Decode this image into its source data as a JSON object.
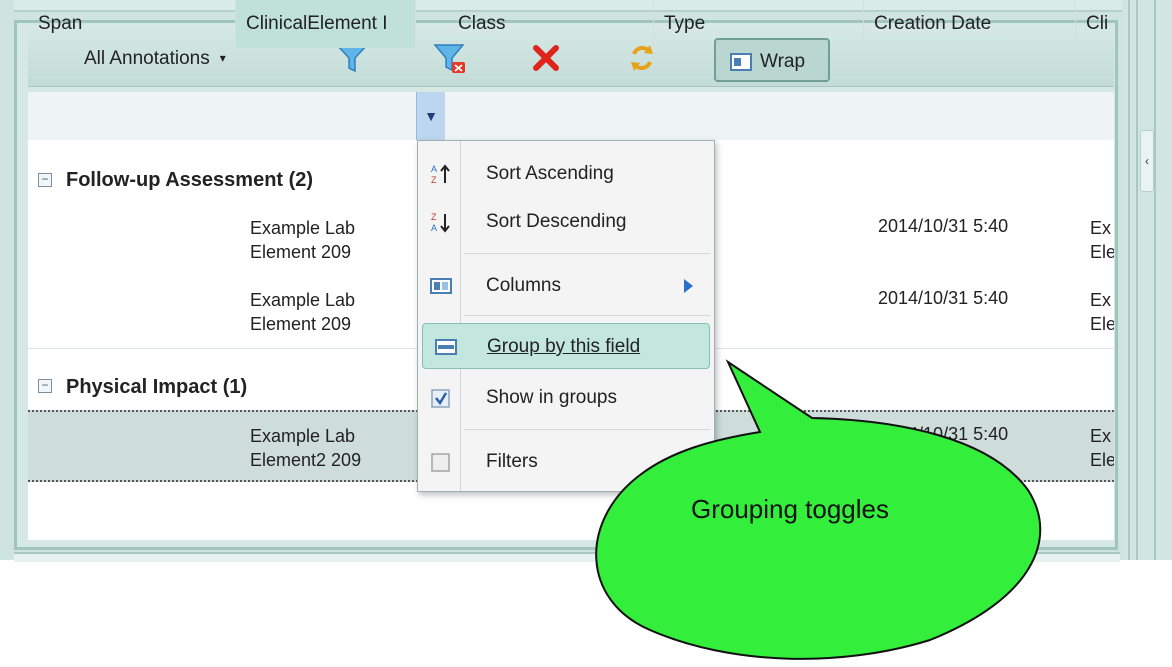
{
  "toolbar": {
    "view_select": "All Annotations",
    "wrap_label": "Wrap",
    "icons": [
      "filter-icon",
      "clear-filter-icon",
      "delete-icon",
      "refresh-icon",
      "wrap-icon"
    ]
  },
  "columns": [
    {
      "label": "Span"
    },
    {
      "label": "ClinicalElement I"
    },
    {
      "label": "Class"
    },
    {
      "label": "Type"
    },
    {
      "label": "Creation Date"
    },
    {
      "label": "Cli"
    }
  ],
  "groups": [
    {
      "label": "Follow-up Assessment (2)",
      "rows": [
        {
          "element_line1": "Example Lab",
          "element_line2": "Element 209",
          "date": "2014/10/31 5:40",
          "cli_line1": "Ex",
          "cli_line2": "Ele"
        },
        {
          "element_line1": "Example Lab",
          "element_line2": "Element 209",
          "date": "2014/10/31 5:40",
          "cli_line1": "Ex",
          "cli_line2": "Ele"
        }
      ]
    },
    {
      "label": "Physical Impact (1)",
      "rows": [
        {
          "element_line1": "Example Lab",
          "element_line2": "Element2 209",
          "date": "2014/10/31 5:40",
          "cli_line1": "Ex",
          "cli_line2": "Ele"
        }
      ]
    }
  ],
  "menu": {
    "items": [
      {
        "label": "Sort Ascending",
        "icon": "sort-ascending-icon"
      },
      {
        "label": "Sort Descending",
        "icon": "sort-descending-icon"
      },
      {
        "label": "Columns",
        "icon": "columns-icon"
      },
      {
        "label": "Group by this field",
        "icon": "group-by-icon"
      },
      {
        "label": "Show in groups",
        "icon": "checkbox-checked-icon"
      },
      {
        "label": "Filters",
        "icon": "checkbox-unchecked-icon"
      }
    ]
  },
  "callout": {
    "text": "Grouping toggles",
    "fill": "#33ee3a"
  }
}
